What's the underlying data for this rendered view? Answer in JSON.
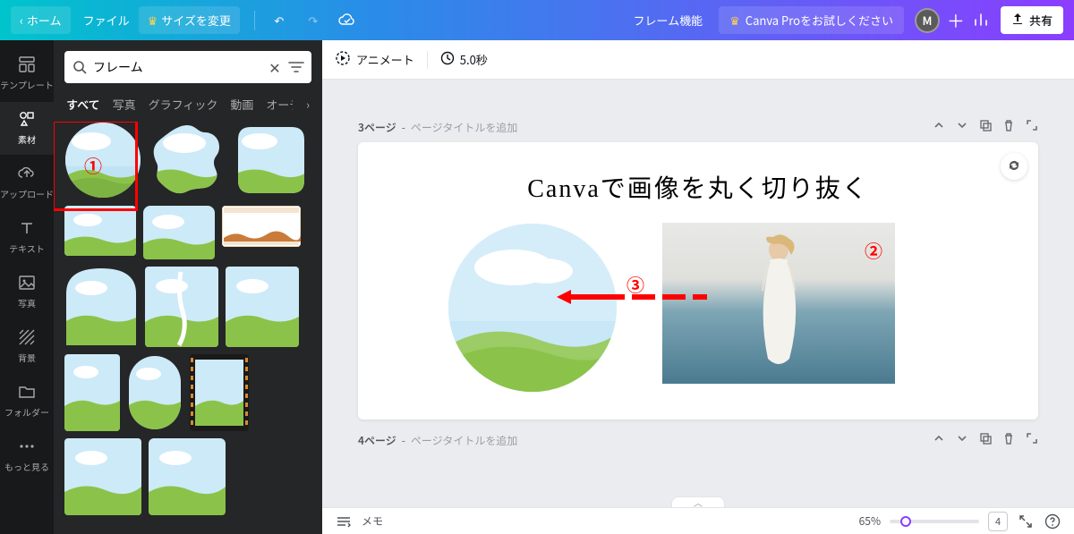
{
  "topbar": {
    "home": "ホーム",
    "file": "ファイル",
    "resize": "サイズを変更",
    "frame_feature": "フレーム機能",
    "try_pro": "Canva Proをお試しください",
    "share": "共有",
    "avatar_initial": "M"
  },
  "rail": {
    "items": [
      {
        "label": "テンプレート"
      },
      {
        "label": "素材"
      },
      {
        "label": "アップロード"
      },
      {
        "label": "テキスト"
      },
      {
        "label": "写真"
      },
      {
        "label": "背景"
      },
      {
        "label": "フォルダー"
      },
      {
        "label": "もっと見る"
      }
    ]
  },
  "search": {
    "value": "フレーム"
  },
  "filters": {
    "tabs": [
      "すべて",
      "写真",
      "グラフィック",
      "動画",
      "オーディオ"
    ]
  },
  "toolbar": {
    "animate": "アニメート",
    "duration": "5.0秒"
  },
  "pages": {
    "p3_num": "3ページ",
    "p3_hint": "ページタイトルを追加",
    "p4_num": "4ページ",
    "p4_hint": "ページタイトルを追加",
    "canvas_title": "Canvaで画像を丸く切り抜く"
  },
  "bottom": {
    "notes": "メモ",
    "zoom": "65%",
    "page_count": "4"
  },
  "annot": {
    "a1": "①",
    "a2": "②",
    "a3": "③"
  }
}
